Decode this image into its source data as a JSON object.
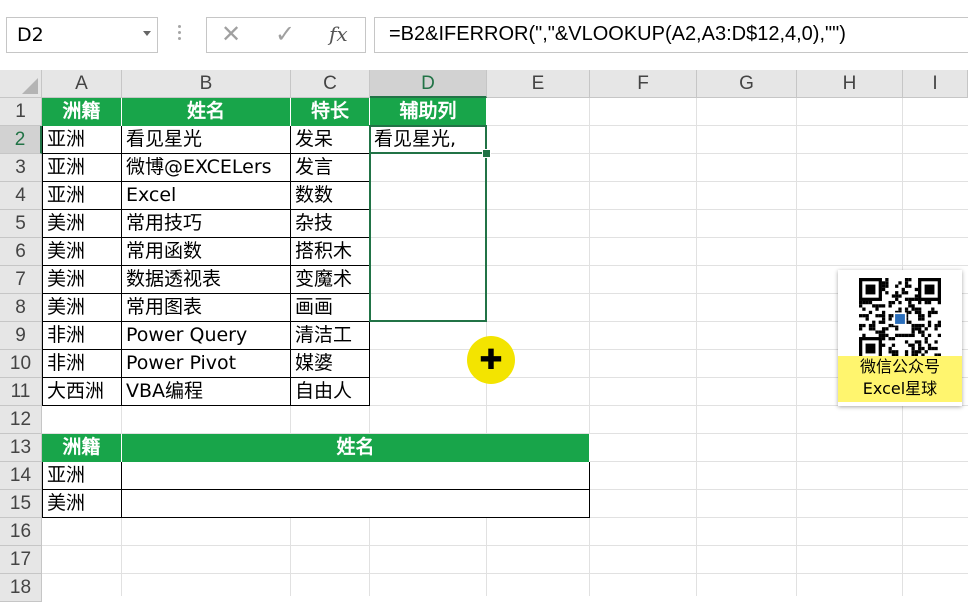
{
  "name_box": {
    "value": "D2"
  },
  "formula_bar": {
    "fx_label": "fx",
    "formula": "=B2&IFERROR(\",\"&VLOOKUP(A2,A3:D$12,4,0),\"\")"
  },
  "columns": [
    "A",
    "B",
    "C",
    "D",
    "E",
    "F",
    "G",
    "H",
    "I"
  ],
  "rows": [
    "1",
    "2",
    "3",
    "4",
    "5",
    "6",
    "7",
    "8",
    "9",
    "10",
    "11",
    "12",
    "13",
    "14",
    "15",
    "16",
    "17",
    "18"
  ],
  "selected_cell": {
    "column": "D",
    "row": "2"
  },
  "table1": {
    "headers": [
      "洲籍",
      "姓名",
      "特长",
      "辅助列"
    ],
    "rows": [
      [
        "亚洲",
        "看见星光",
        "发呆",
        "看见星光,"
      ],
      [
        "亚洲",
        "微博@EXCELers",
        "发言",
        ""
      ],
      [
        "亚洲",
        "Excel",
        "数数",
        ""
      ],
      [
        "美洲",
        "常用技巧",
        "杂技",
        ""
      ],
      [
        "美洲",
        "常用函数",
        "搭积木",
        ""
      ],
      [
        "美洲",
        "数据透视表",
        "变魔术",
        ""
      ],
      [
        "美洲",
        "常用图表",
        "画画",
        ""
      ],
      [
        "非洲",
        "Power Query",
        "清洁工",
        ""
      ],
      [
        "非洲",
        "Power Pivot",
        "媒婆",
        ""
      ],
      [
        "大西洲",
        "VBA编程",
        "自由人",
        ""
      ]
    ]
  },
  "table2": {
    "headers": [
      "洲籍",
      "姓名"
    ],
    "rows": [
      [
        "亚洲",
        ""
      ],
      [
        "美洲",
        ""
      ]
    ]
  },
  "watermark": {
    "line1": "微信公众号",
    "line2": "Excel星球"
  },
  "colors": {
    "header_green": "#18a54a",
    "selection_green": "#217346",
    "cursor_yellow": "#f3e400",
    "caption_yellow": "#fff56e"
  }
}
